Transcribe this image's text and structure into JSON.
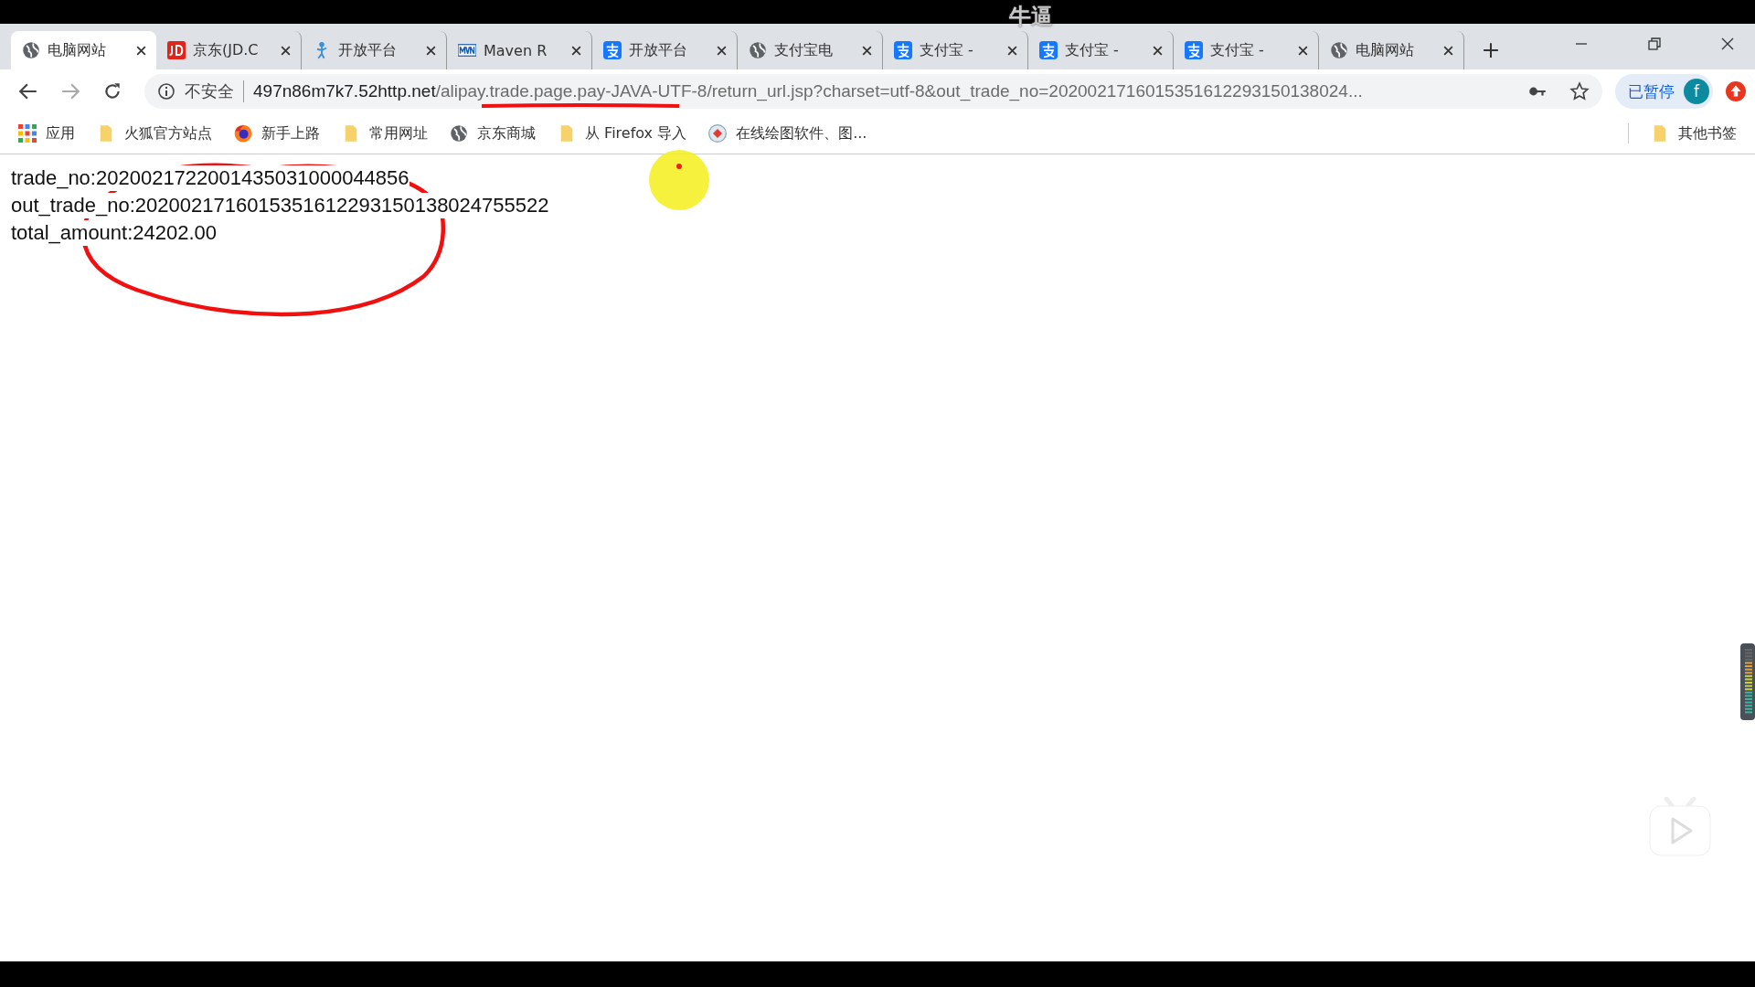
{
  "overlay_comment": "牛逼",
  "tabs": [
    {
      "title": "电脑网站",
      "kind": "globe",
      "selected": true
    },
    {
      "title": "京东(JD.C",
      "kind": "jd",
      "selected": false
    },
    {
      "title": "开放平台",
      "kind": "figure",
      "selected": false
    },
    {
      "title": "Maven R",
      "kind": "mvn",
      "selected": false
    },
    {
      "title": "开放平台",
      "kind": "alipay",
      "selected": false
    },
    {
      "title": "支付宝电",
      "kind": "globe",
      "selected": false
    },
    {
      "title": "支付宝 -",
      "kind": "alipay",
      "selected": false
    },
    {
      "title": "支付宝 -",
      "kind": "alipay",
      "selected": false
    },
    {
      "title": "支付宝 -",
      "kind": "alipay",
      "selected": false
    },
    {
      "title": "电脑网站",
      "kind": "globe",
      "selected": false
    }
  ],
  "address_bar": {
    "security_label": "不安全",
    "host": "497n86m7k7.52http.net",
    "path": "/alipay.trade.page.pay-JAVA-UTF-8/return_url.jsp?charset=utf-8&out_trade_no=2020021716015351612293150138024..."
  },
  "profile": {
    "status": "已暂停",
    "avatar_letter": "f"
  },
  "bookmarks": [
    {
      "label": "应用",
      "kind": "apps"
    },
    {
      "label": "火狐官方站点",
      "kind": "folder"
    },
    {
      "label": "新手上路",
      "kind": "firefox"
    },
    {
      "label": "常用网址",
      "kind": "folder"
    },
    {
      "label": "京东商城",
      "kind": "globe"
    },
    {
      "label": "从 Firefox 导入",
      "kind": "folder"
    },
    {
      "label": "在线绘图软件、图...",
      "kind": "drawio"
    }
  ],
  "other_bookmarks": "其他书签",
  "page_lines": [
    "trade_no:2020021722001435031000044856",
    "out_trade_no:2020021716015351612293150138024755522",
    "total_amount:24202.00"
  ]
}
